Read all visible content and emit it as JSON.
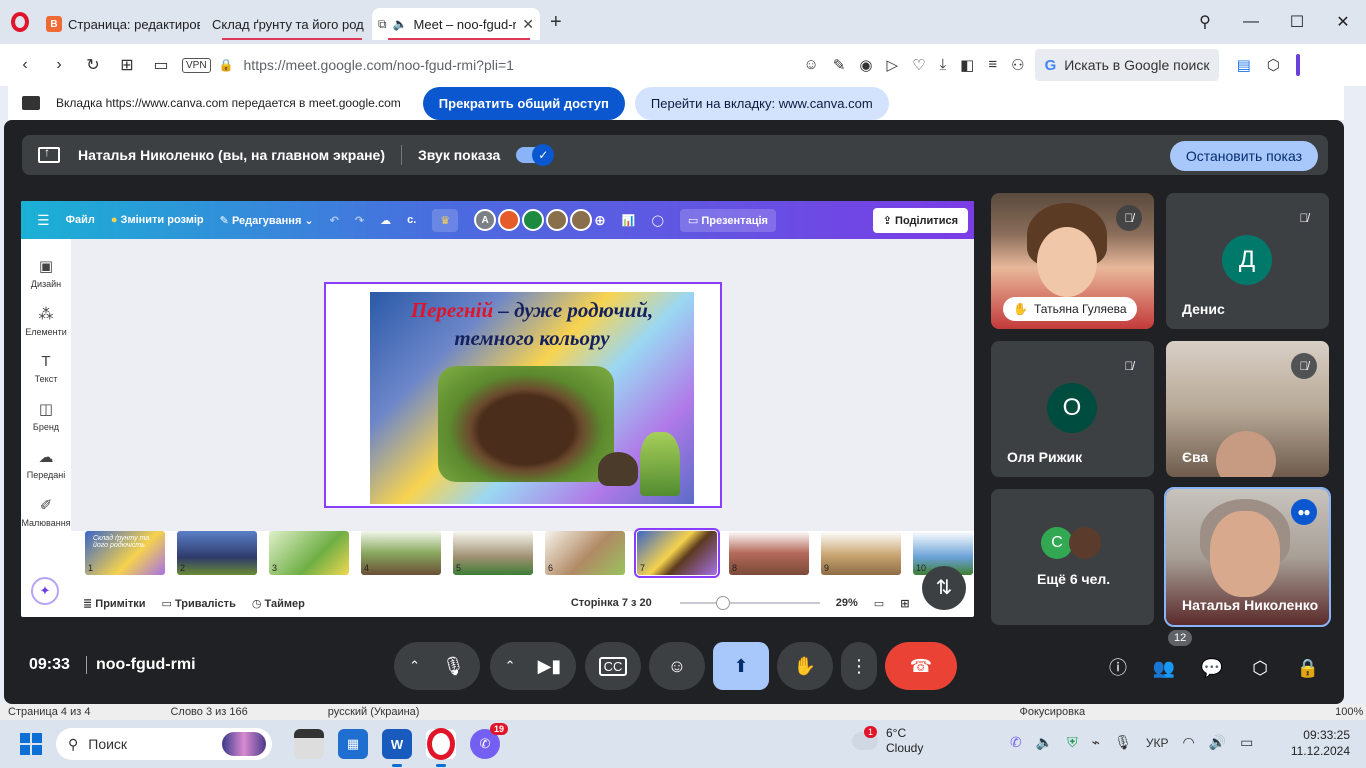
{
  "browser": {
    "tabs": [
      {
        "title": "Страница: редактирован",
        "icon": "blogger-icon"
      },
      {
        "title": "Склад ґрунту та його род",
        "icon": "canva-icon"
      },
      {
        "title": "Meet – noo-fgud-r",
        "icon": "meet-icon"
      }
    ],
    "vpn_label": "VPN",
    "url": "https://meet.google.com/noo-fgud-rmi?pli=1",
    "search_placeholder": "Искать в Google поиск"
  },
  "share_bar": {
    "message": "Вкладка https://www.canva.com передается в meet.google.com",
    "stop_label": "Прекратить общий доступ",
    "goto_label": "Перейти на вкладку: www.canva.com"
  },
  "meet": {
    "presenter_text": "Наталья Николенко (вы, на главном экране)",
    "sound_label": "Звук показа",
    "stop_present_label": "Остановить показ",
    "time": "09:33",
    "code": "noo-fgud-rmi",
    "people_count": "12",
    "participants": [
      {
        "name": "Татьяна Гуляева"
      },
      {
        "name": "Денис",
        "initial": "Д",
        "color": "#00796b"
      },
      {
        "name": "Оля Рижик",
        "initial": "О",
        "color": "#004d40"
      },
      {
        "name": "Єва"
      },
      {
        "name": "Ещё 6 чел.",
        "initial": "С",
        "color": "#33a852"
      },
      {
        "name": "Наталья Николенко"
      }
    ]
  },
  "canva": {
    "file_label": "Файл",
    "resize_label": "Змінити розмір",
    "edit_label": "Редагування",
    "collab_letter": "A",
    "present_label": "Презентація",
    "share_label": "Поділитися",
    "c_label": "с.",
    "side": [
      {
        "label": "Дизайн",
        "icon": "design-icon"
      },
      {
        "label": "Елементи",
        "icon": "elements-icon"
      },
      {
        "label": "Текст",
        "icon": "text-icon"
      },
      {
        "label": "Бренд",
        "icon": "brand-icon"
      },
      {
        "label": "Передані",
        "icon": "uploads-icon"
      },
      {
        "label": "Малювання",
        "icon": "draw-icon"
      }
    ],
    "slide_title_red": "Перегній",
    "slide_title_rest_1": " – дуже  родючий,",
    "slide_title_rest_2": "темного кольору",
    "thumbs": [
      "1",
      "2",
      "3",
      "4",
      "5",
      "6",
      "7",
      "8",
      "9",
      "10"
    ],
    "thumb1_text": "Склад ґрунту та його родючість",
    "notes_label": "Примітки",
    "duration_label": "Тривалість",
    "timer_label": "Таймер",
    "page_label": "Сторінка 7 з 20",
    "zoom_label": "29%"
  },
  "word_status": {
    "page": "Страница 4 из 4",
    "words": "Слово 3 из 166",
    "lang": "русский (Украина)",
    "focus": "Фокусировка",
    "zoom": "100%"
  },
  "taskbar": {
    "search_label": "Поиск",
    "viber_badge": "19",
    "weather_badge": "1",
    "temp": "6°C",
    "condition": "Cloudy",
    "lang": "УКР",
    "time": "09:33:25",
    "date": "11.12.2024"
  }
}
